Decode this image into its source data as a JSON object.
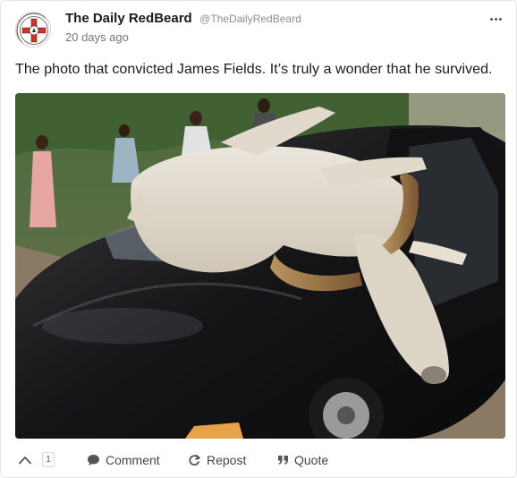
{
  "post": {
    "author_name": "The Daily RedBeard",
    "author_handle": "@TheDailyRedBeard",
    "timestamp": "20 days ago",
    "text": "The photo that convicted James Fields. It’s truly a wonder that he survived."
  },
  "image": {
    "description_icon": "photo-cow-on-car"
  },
  "actions": {
    "vote_count": "1",
    "comment_label": "Comment",
    "repost_label": "Repost",
    "quote_label": "Quote"
  },
  "colors": {
    "text": "#1a1a1a",
    "muted": "#777777",
    "border": "#e6e6e6",
    "accent_red": "#c8352b"
  }
}
